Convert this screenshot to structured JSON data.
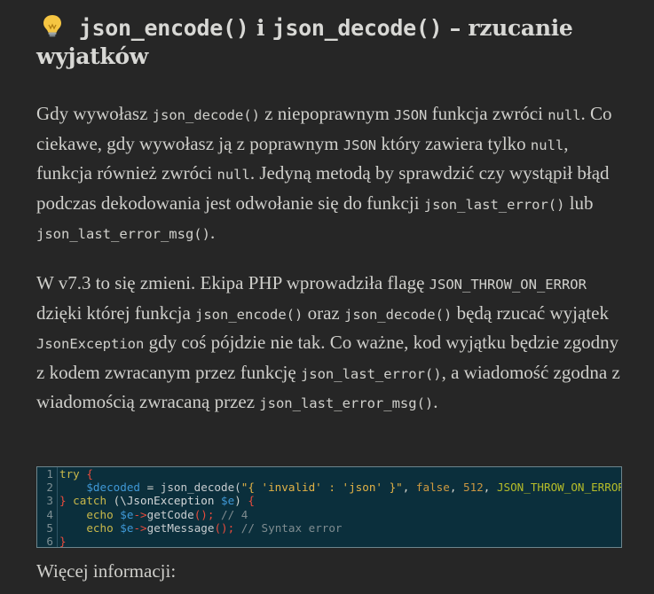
{
  "heading": {
    "icon": "lightbulb-icon",
    "fn1": "json_encode()",
    "conj": " i ",
    "fn2": "json_decode()",
    "dash": " – ",
    "rest": "rzucanie",
    "line2": "wyjatków"
  },
  "paragraph1": {
    "t1": "Gdy wywołasz ",
    "c1": "json_decode()",
    "t2": " z niepoprawnym ",
    "c2": "JSON",
    "t3": " funkcja zwróci ",
    "c3": "null",
    "t4": ". Co ciekawe, gdy wywołasz ją z  poprawnym ",
    "c4": "JSON",
    "t5": " który zawiera tylko ",
    "c5": "null",
    "t6": ", funkcja również zwróci ",
    "c6": "null",
    "t7": ". Jedyną metodą by sprawdzić czy wystąpił błąd podczas dekodowania jest odwołanie się do funkcji ",
    "c7": "json_last_error()",
    "t8": " lub ",
    "c8": "json_last_error_msg()",
    "t9": "."
  },
  "paragraph2": {
    "t1": "W v7.3 to się zmieni. Ekipa PHP wprowadziła flagę ",
    "c1": "JSON_THROW_ON_ERROR",
    "t2": " dzięki której funkcja ",
    "c2": "json_encode()",
    "t3": " oraz ",
    "c3": "json_decode()",
    "t4": " będą rzucać wyjątek ",
    "c4": "JsonException",
    "t5": " gdy coś pójdzie nie tak. Co ważne, kod wyjątku będzie zgodny z kodem zwracanym przez funkcję ",
    "c5": "json_last_error()",
    "t6": ", a wiadomość zgodna z wiadomością zwracaną przez ",
    "c6": "json_last_error_msg()",
    "t7": "."
  },
  "code": {
    "line_numbers": [
      "1",
      "2",
      "3",
      "4",
      "5",
      "6"
    ],
    "l1": {
      "kw": "try",
      "brace": " {"
    },
    "l2": {
      "indent": "    ",
      "var": "$decoded",
      "op": " = ",
      "fn": "json_decode(",
      "str": "\"{ 'invalid' : 'json' }\"",
      "sep1": ", ",
      "bool": "false",
      "sep2": ", ",
      "num": "512",
      "sep3": ", ",
      "const": "JSON_THROW_ON_ERROR);"
    },
    "l3": {
      "brace": "} ",
      "kw": "catch",
      "p1": " (",
      "cls": "\\JsonException",
      "sp": " ",
      "var": "$e",
      "p2": ") ",
      "brace2": "{"
    },
    "l4": {
      "indent": "    ",
      "kw": "echo",
      "sp": " ",
      "var": "$e",
      "arrow": "->",
      "fn": "getCode",
      "call": "();",
      "comment": " // 4"
    },
    "l5": {
      "indent": "    ",
      "kw": "echo",
      "sp": " ",
      "var": "$e",
      "arrow": "->",
      "fn": "getMessage",
      "call": "();",
      "comment": " // Syntax error"
    },
    "l6": {
      "brace": "}"
    }
  },
  "more_info": "Więcej informacji:"
}
